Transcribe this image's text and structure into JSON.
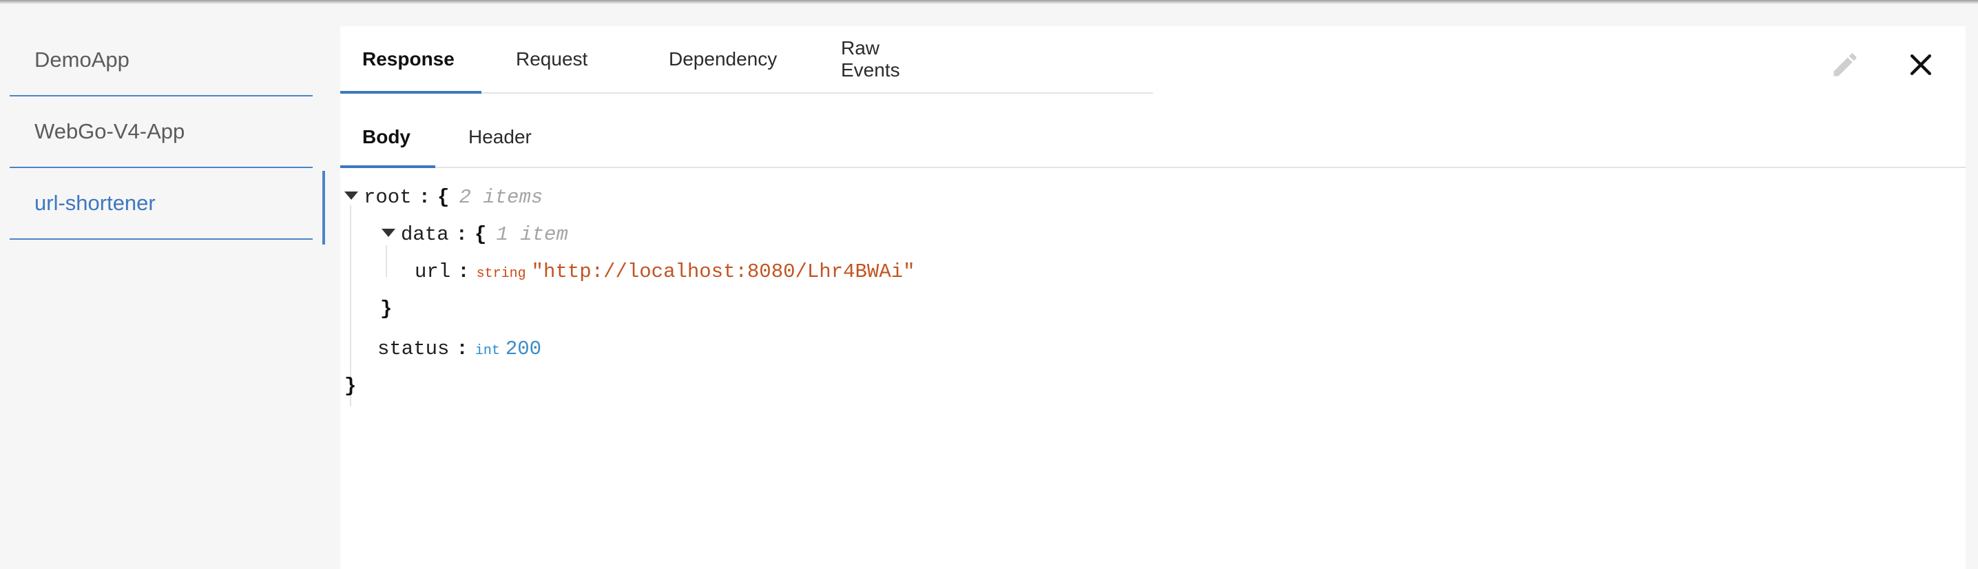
{
  "sidebar": {
    "items": [
      {
        "label": "DemoApp"
      },
      {
        "label": "WebGo-V4-App"
      },
      {
        "label": "url-shortener"
      }
    ],
    "active_index": 2
  },
  "tabs": {
    "response": "Response",
    "request": "Request",
    "dependency": "Dependency",
    "raw_events": "Raw Events",
    "active": "Response"
  },
  "subtabs": {
    "body": "Body",
    "header": "Header",
    "active": "Body"
  },
  "icons": {
    "edit": "pencil-icon",
    "close": "close-icon"
  },
  "json_viewer": {
    "root_key": "root",
    "root_open": "{",
    "root_meta": "2 items",
    "data_key": "data",
    "data_open": "{",
    "data_meta": "1 item",
    "url_key": "url",
    "url_type": "string",
    "url_value": "\"http://localhost:8080/Lhr4BWAi\"",
    "data_close": "}",
    "status_key": "status",
    "status_type": "int",
    "status_value": "200",
    "root_close": "}",
    "colon": ":"
  },
  "colors": {
    "accent": "#3c78bf",
    "string_value": "#c25422",
    "int_value": "#3c8bc4"
  }
}
